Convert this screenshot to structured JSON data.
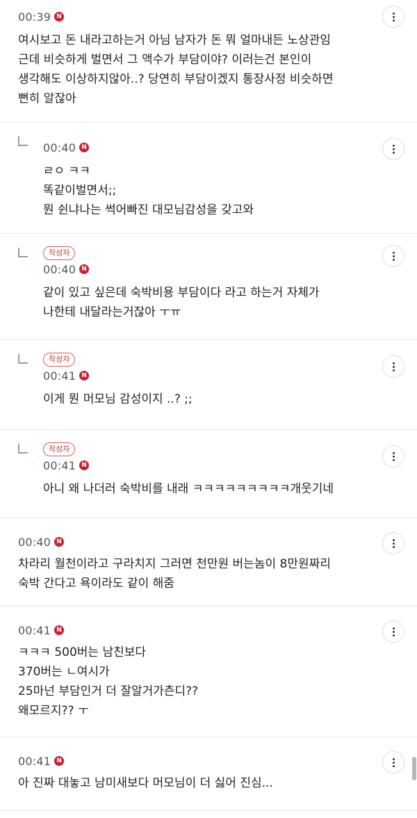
{
  "comments": [
    {
      "time": "00:39",
      "lines": [
        "여시보고 돈 내라고하는거 아님 남자가 돈 뭐 얼마내든 노상관임",
        "근데 비슷하게 벌면서 그 액수가 부담이야? 이러는건 본인이",
        "생각해도 이상하지않아..? 당연히 부담이겠지 통장사정 비슷하면",
        "뻔히 알잖아"
      ]
    },
    {
      "time": "00:40",
      "lines": [
        "ㄹㅇ ㅋㅋ",
        "똑같이벌면서;;",
        "뭔 쉰냐나는 썩어빠진 대모님감성을 갖고와"
      ]
    },
    {
      "badge": "작성자",
      "time": "00:40",
      "lines": [
        "같이 있고 싶은데 숙박비용 부담이다 라고 하는거 자체가",
        "나한테 내달라는거잖아 ㅜㅠ"
      ]
    },
    {
      "badge": "작성자",
      "time": "00:41",
      "lines": [
        "이게 뭔 머모님 감성이지 ..? ;;"
      ]
    },
    {
      "badge": "작성자",
      "time": "00:41",
      "lines": [
        "아니 왜 나더러 숙박비를 내래 ㅋㅋㅋㅋㅋㅋㅋㅋㅋ개웃기네"
      ]
    },
    {
      "time": "00:40",
      "lines": [
        "차라리 월천이라고 구라치지 그러면 천만원 버는놈이 8만원짜리",
        "숙박 간다고 욕이라도 같이 해줌"
      ]
    },
    {
      "time": "00:41",
      "lines": [
        "ㅋㅋㅋ 500버는 남친보다",
        "370버는 ㄴ여시가",
        "25마넌 부담인거 더 잘알거가츤디??",
        "왜모르지?? ㅜ"
      ]
    },
    {
      "time": "00:41",
      "lines": [
        "아 진짜 대놓고 남미새보다 머모님이 더 싫어 진심..."
      ]
    }
  ],
  "new_badge": "N",
  "colors": {
    "accent": "#c8202f",
    "divider": "#e6e6e6",
    "text": "#222222",
    "meta": "#555555"
  },
  "icons": {
    "more": "vertical-ellipsis-icon",
    "reply": "reply-arrow-icon",
    "new": "new-badge-icon"
  }
}
